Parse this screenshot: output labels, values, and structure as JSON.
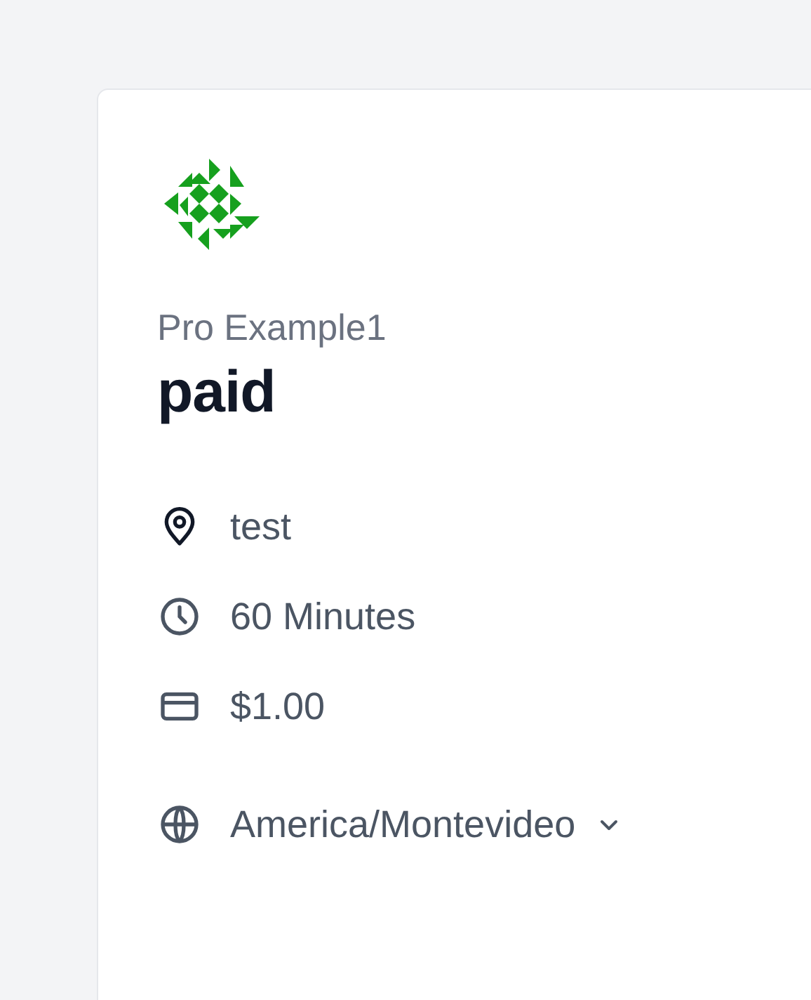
{
  "event": {
    "owner": "Pro Example1",
    "title": "paid"
  },
  "details": [
    {
      "kind": "location",
      "text": "test"
    },
    {
      "kind": "duration",
      "text": "60 Minutes"
    },
    {
      "kind": "price",
      "text": "$1.00"
    },
    {
      "kind": "timezone",
      "text": "America/Montevideo"
    }
  ]
}
